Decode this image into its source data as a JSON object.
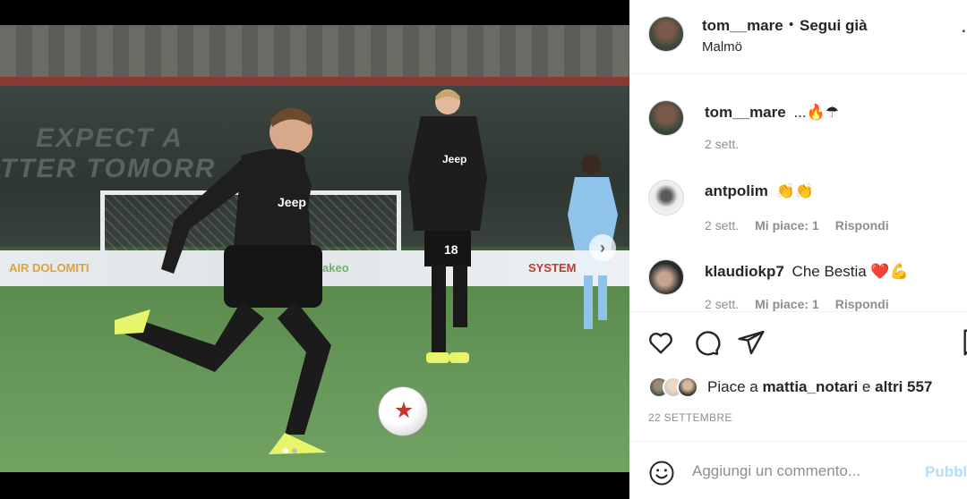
{
  "post": {
    "image_alt": "",
    "slogan_line1": "EXPECT A",
    "slogan_line2": "TTER TOMORR",
    "hoarding": [
      "AIR DOLOMITI",
      "akeo",
      "SYSTEM"
    ],
    "player_numbers": [
      "18"
    ],
    "carousel": {
      "dots": 2,
      "active_dot": 0
    }
  },
  "header": {
    "username": "tom__mare",
    "separator": "•",
    "follow_label": "Segui già",
    "location": "Malmö",
    "more_icon": "more-icon"
  },
  "comments": [
    {
      "username": "tom__mare",
      "text": "...🔥☂",
      "time": "2 sett."
    },
    {
      "username": "antpolim",
      "text": "👏👏",
      "time": "2 sett.",
      "likes": "Mi piace: 1",
      "reply": "Rispondi"
    },
    {
      "username": "klaudiokp7",
      "text": "Che Bestia ❤️💪",
      "time": "2 sett.",
      "likes": "Mi piace: 1",
      "reply": "Rispondi"
    }
  ],
  "actions": {
    "like_icon": "heart-icon",
    "comment_icon": "comment-icon",
    "share_icon": "share-icon",
    "save_icon": "bookmark-icon"
  },
  "likes": {
    "prefix": "Piace a",
    "user": "mattia_notari",
    "conjunction": "e",
    "others": "altri 557"
  },
  "date": "22 SETTEMBRE",
  "add_comment": {
    "placeholder": "Aggiungi un commento...",
    "publish_label": "Pubblica"
  },
  "colors": {
    "publish_disabled": "#b2dffc",
    "meta_gray": "#8e8e8e",
    "text": "#262626"
  }
}
